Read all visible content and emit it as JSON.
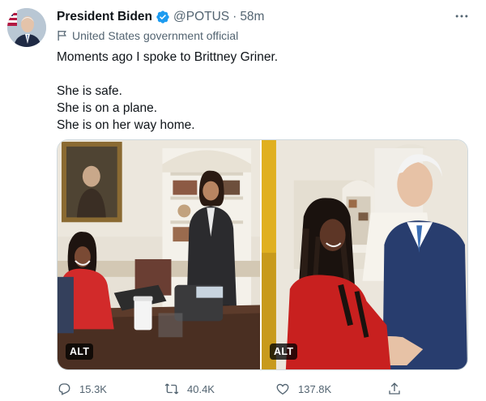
{
  "author": {
    "name": "President Biden",
    "handle": "@POTUS",
    "separator": "·",
    "time": "58m",
    "label": "United States government official",
    "verified_color": "#1d9bf0"
  },
  "tweet": {
    "lines": [
      "Moments ago I spoke to Brittney Griner.",
      "",
      "She is safe.",
      "She is on a plane.",
      "She is on her way home."
    ]
  },
  "media": {
    "images": [
      {
        "alt_badge": "ALT"
      },
      {
        "alt_badge": "ALT"
      }
    ]
  },
  "actions": {
    "reply_count": "15.3K",
    "retweet_count": "40.4K",
    "like_count": "137.8K"
  },
  "colors": {
    "text": "#0f1419",
    "muted": "#536471",
    "border": "#cfd9de"
  },
  "icons": {
    "more": "more-icon",
    "label": "flag-icon",
    "reply": "reply-icon",
    "retweet": "retweet-icon",
    "like": "heart-icon",
    "share": "share-icon"
  }
}
